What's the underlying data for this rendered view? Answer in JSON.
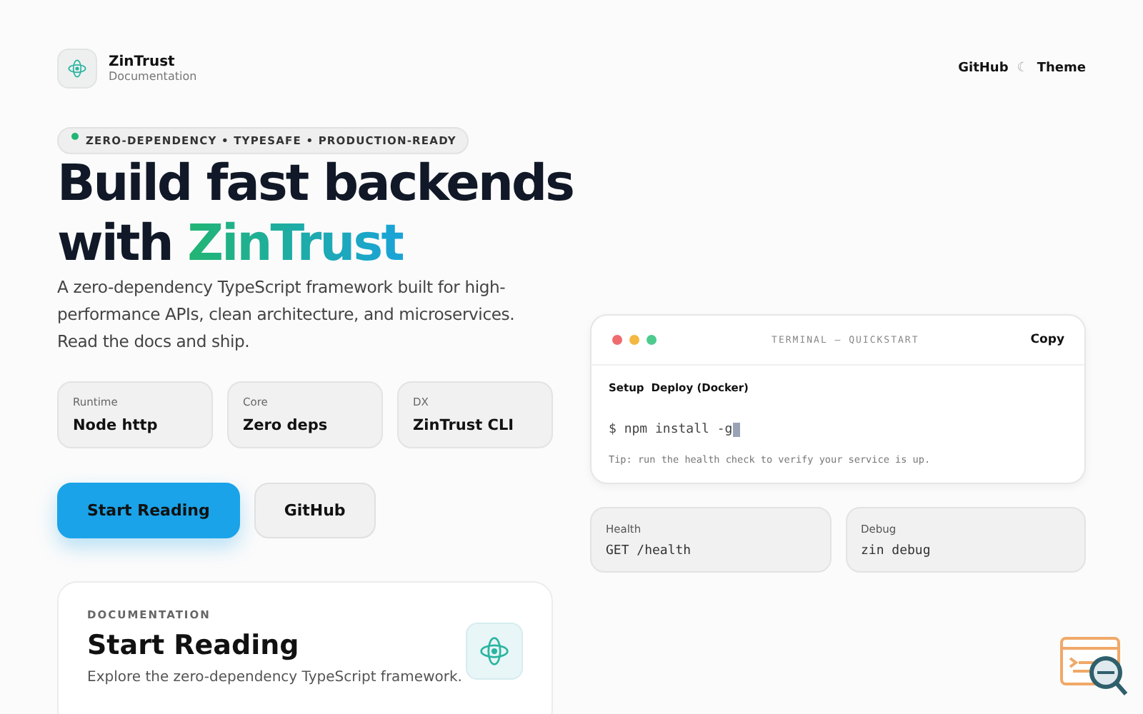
{
  "brand": {
    "name": "ZinTrust",
    "subtitle": "Documentation"
  },
  "nav": {
    "links": [
      "GitHub",
      "Theme"
    ],
    "separator": "☾"
  },
  "hero": {
    "badge": "ZERO-DEPENDENCY • TYPESAFE • PRODUCTION-READY",
    "title_line1": "Build fast backends",
    "title_prefix": "with ",
    "title_highlight": "ZinTrust",
    "description": "A zero-dependency TypeScript framework built for high-performance APIs, clean architecture, and microservices. Read the docs and ship."
  },
  "stats": [
    {
      "label": "Runtime",
      "value": "Node http"
    },
    {
      "label": "Core",
      "value": "Zero deps"
    },
    {
      "label": "DX",
      "value": "ZinTrust CLI"
    }
  ],
  "buttons": [
    {
      "label": "Start Reading",
      "kind": "primary"
    },
    {
      "label": "GitHub",
      "kind": "secondary"
    }
  ],
  "doc_card": {
    "eyebrow": "DOCUMENTATION",
    "title": "Start Reading",
    "text": "Explore the zero-dependency TypeScript framework."
  },
  "terminal": {
    "title": "TERMINAL — QUICKSTART",
    "copy": "Copy",
    "tabs": [
      "Setup",
      "Deploy (Docker)"
    ],
    "command": "$ npm install -g",
    "tip": "Tip: run the health check to verify your service is up."
  },
  "commands": [
    {
      "label": "Health",
      "value": "GET /health"
    },
    {
      "label": "Debug",
      "value": "zin debug"
    }
  ]
}
